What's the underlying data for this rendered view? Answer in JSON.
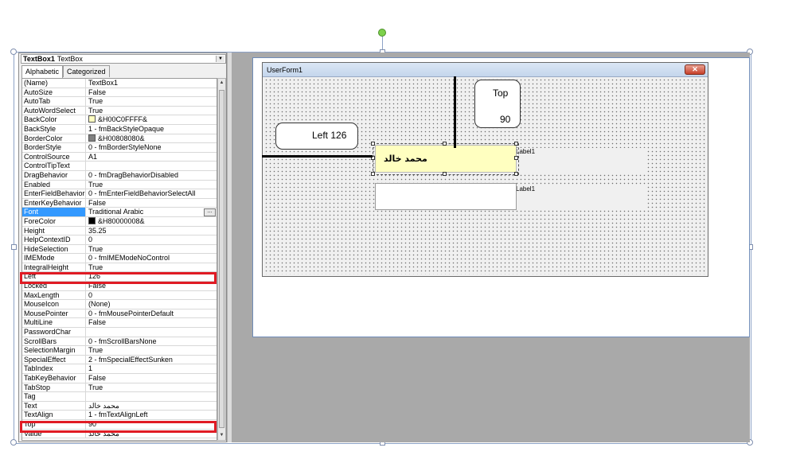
{
  "properties_panel": {
    "object_name": "TextBox1",
    "object_type": "TextBox",
    "tabs": [
      {
        "label": "Alphabetic",
        "active": true
      },
      {
        "label": "Categorized",
        "active": false
      }
    ],
    "selected_property": "Font",
    "highlighted_properties": [
      "Left",
      "Top"
    ],
    "rows": [
      {
        "name": "(Name)",
        "value": "TextBox1"
      },
      {
        "name": "AutoSize",
        "value": "False"
      },
      {
        "name": "AutoTab",
        "value": "True"
      },
      {
        "name": "AutoWordSelect",
        "value": "True"
      },
      {
        "name": "BackColor",
        "value": "&H00C0FFFF&",
        "swatch": "#ffffc0"
      },
      {
        "name": "BackStyle",
        "value": "1 - fmBackStyleOpaque"
      },
      {
        "name": "BorderColor",
        "value": "&H00808080&",
        "swatch": "#808080"
      },
      {
        "name": "BorderStyle",
        "value": "0 - fmBorderStyleNone"
      },
      {
        "name": "ControlSource",
        "value": "A1"
      },
      {
        "name": "ControlTipText",
        "value": ""
      },
      {
        "name": "DragBehavior",
        "value": "0 - fmDragBehaviorDisabled"
      },
      {
        "name": "Enabled",
        "value": "True"
      },
      {
        "name": "EnterFieldBehavior",
        "value": "0 - fmEnterFieldBehaviorSelectAll"
      },
      {
        "name": "EnterKeyBehavior",
        "value": "False"
      },
      {
        "name": "Font",
        "value": "Traditional Arabic",
        "ellipsis": "..."
      },
      {
        "name": "ForeColor",
        "value": "&H80000008&",
        "swatch": "#000000"
      },
      {
        "name": "Height",
        "value": "35.25"
      },
      {
        "name": "HelpContextID",
        "value": "0"
      },
      {
        "name": "HideSelection",
        "value": "True"
      },
      {
        "name": "IMEMode",
        "value": "0 - fmIMEModeNoControl"
      },
      {
        "name": "IntegralHeight",
        "value": "True"
      },
      {
        "name": "Left",
        "value": "126"
      },
      {
        "name": "Locked",
        "value": "False"
      },
      {
        "name": "MaxLength",
        "value": "0"
      },
      {
        "name": "MouseIcon",
        "value": "(None)"
      },
      {
        "name": "MousePointer",
        "value": "0 - fmMousePointerDefault"
      },
      {
        "name": "MultiLine",
        "value": "False"
      },
      {
        "name": "PasswordChar",
        "value": ""
      },
      {
        "name": "ScrollBars",
        "value": "0 - fmScrollBarsNone"
      },
      {
        "name": "SelectionMargin",
        "value": "True"
      },
      {
        "name": "SpecialEffect",
        "value": "2 - fmSpecialEffectSunken"
      },
      {
        "name": "TabIndex",
        "value": "1"
      },
      {
        "name": "TabKeyBehavior",
        "value": "False"
      },
      {
        "name": "TabStop",
        "value": "True"
      },
      {
        "name": "Tag",
        "value": ""
      },
      {
        "name": "Text",
        "value": "محمد خالد"
      },
      {
        "name": "TextAlign",
        "value": "1 - fmTextAlignLeft"
      },
      {
        "name": "Top",
        "value": "90"
      },
      {
        "name": "Value",
        "value": "محمد خالد"
      }
    ]
  },
  "userform": {
    "title": "UserForm1",
    "close_glyph": "✕",
    "textbox1_text": "محمد خالد",
    "label1_a": "Label1",
    "label1_b": "Label1"
  },
  "annotations": {
    "left_callout": "Left 126",
    "top_callout_label": "Top",
    "top_callout_value": "90"
  },
  "colors": {
    "selected_row": "#3399ff",
    "highlight_box": "#e01b24",
    "textbox_back": "#ffffc0"
  }
}
